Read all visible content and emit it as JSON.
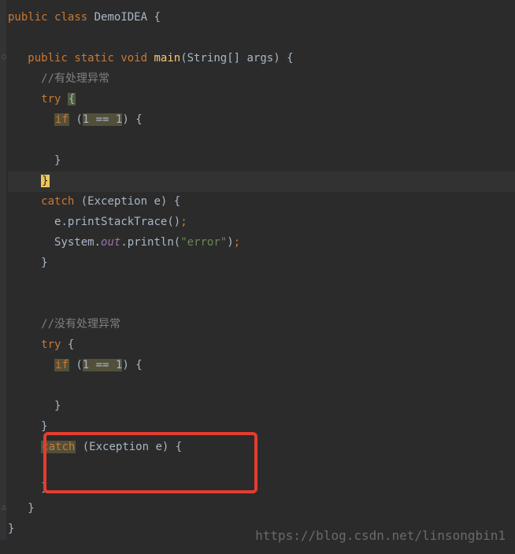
{
  "code": {
    "line1": {
      "kw1": "public",
      "kw2": "class",
      "cls": "DemoIDEA",
      "brace": "{"
    },
    "line2": {
      "kw1": "public",
      "kw2": "static",
      "kw3": "void",
      "method": "main",
      "sig": "(String[] args)",
      "brace": "{"
    },
    "line3": "//有处理异常",
    "line4": {
      "kw": "try",
      "brace": "{"
    },
    "line5": {
      "kw": "if",
      "paren1": "(",
      "cond": "1 == 1",
      "paren2": ")",
      "brace": "{"
    },
    "line6": "}",
    "line7": "}",
    "line8": {
      "kw": "catch",
      "sig": "(Exception e)",
      "brace": "{"
    },
    "line9": {
      "obj": "e",
      "dot": ".",
      "method": "printStackTrace",
      "call": "()",
      "semi": ";"
    },
    "line10": {
      "cls": "System",
      "dot": ".",
      "field": "out",
      "dot2": ".",
      "method": "println",
      "p1": "(",
      "str": "\"error\"",
      "p2": ")",
      "semi": ";"
    },
    "line11": "}",
    "line12": "//没有处理异常",
    "line13": {
      "kw": "try",
      "brace": "{"
    },
    "line14": {
      "kw": "if",
      "paren1": "(",
      "cond": "1 == 1",
      "paren2": ")",
      "brace": "{"
    },
    "line15": "}",
    "line16": "}",
    "line17": {
      "kw": "catch",
      "sig": "(Exception e)",
      "brace": "{"
    },
    "line18": "}",
    "line19": "}",
    "line20": "}"
  },
  "spaces": {
    "s2": "  ",
    "s3": "   ",
    "s5": "     ",
    "s7": "       ",
    "s9": "         "
  },
  "watermark": "https://blog.csdn.net/linsongbin1"
}
